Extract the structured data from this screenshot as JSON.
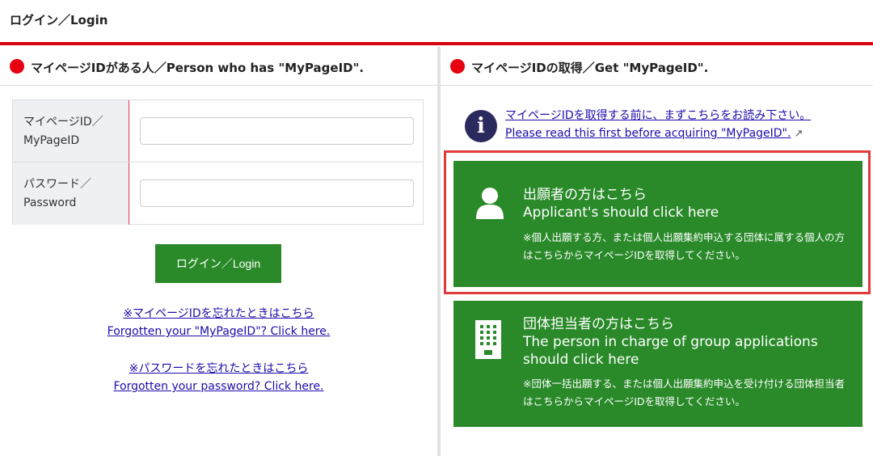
{
  "header": {
    "title": "ログイン／Login"
  },
  "left": {
    "heading": "マイページIDがある人／Person who has \"MyPageID\".",
    "fields": [
      {
        "label_line1": "マイページID／",
        "label_line2": "MyPageID",
        "value": "",
        "placeholder": ""
      },
      {
        "label_line1": "パスワード／",
        "label_line2": "Password",
        "value": "",
        "placeholder": ""
      }
    ],
    "login_button": "ログイン／Login",
    "forgot_id_jp": "※マイページIDを忘れたときはこちら",
    "forgot_id_en": "Forgotten your \"MyPageID\"? Click here.",
    "forgot_pw_jp": "※パスワードを忘れたときはこちら",
    "forgot_pw_en": "Forgotten your password? Click here."
  },
  "right": {
    "heading": "マイページIDの取得／Get \"MyPageID\".",
    "info_link_jp": "マイページIDを取得する前に、まずこちらをお読み下さい。",
    "info_link_en": "Please read this first before acquiring \"MyPageID\".",
    "applicant": {
      "title_jp": "出願者の方はこちら",
      "title_en": "Applicant's should click here",
      "note": "※個人出願する方、または個人出願集約申込する団体に属する個人の方はこちらからマイページIDを取得してください。"
    },
    "group": {
      "title_jp": "団体担当者の方はこちら",
      "title_en": "The person in charge of group applications should click here",
      "note": "※団体一括出願する、または個人出願集約申込を受け付ける団体担当者はこちらからマイページIDを取得してください。"
    }
  },
  "colors": {
    "brand_red": "#d7000f",
    "button_green": "#2a8a2a",
    "link_blue": "#1a0dab"
  }
}
